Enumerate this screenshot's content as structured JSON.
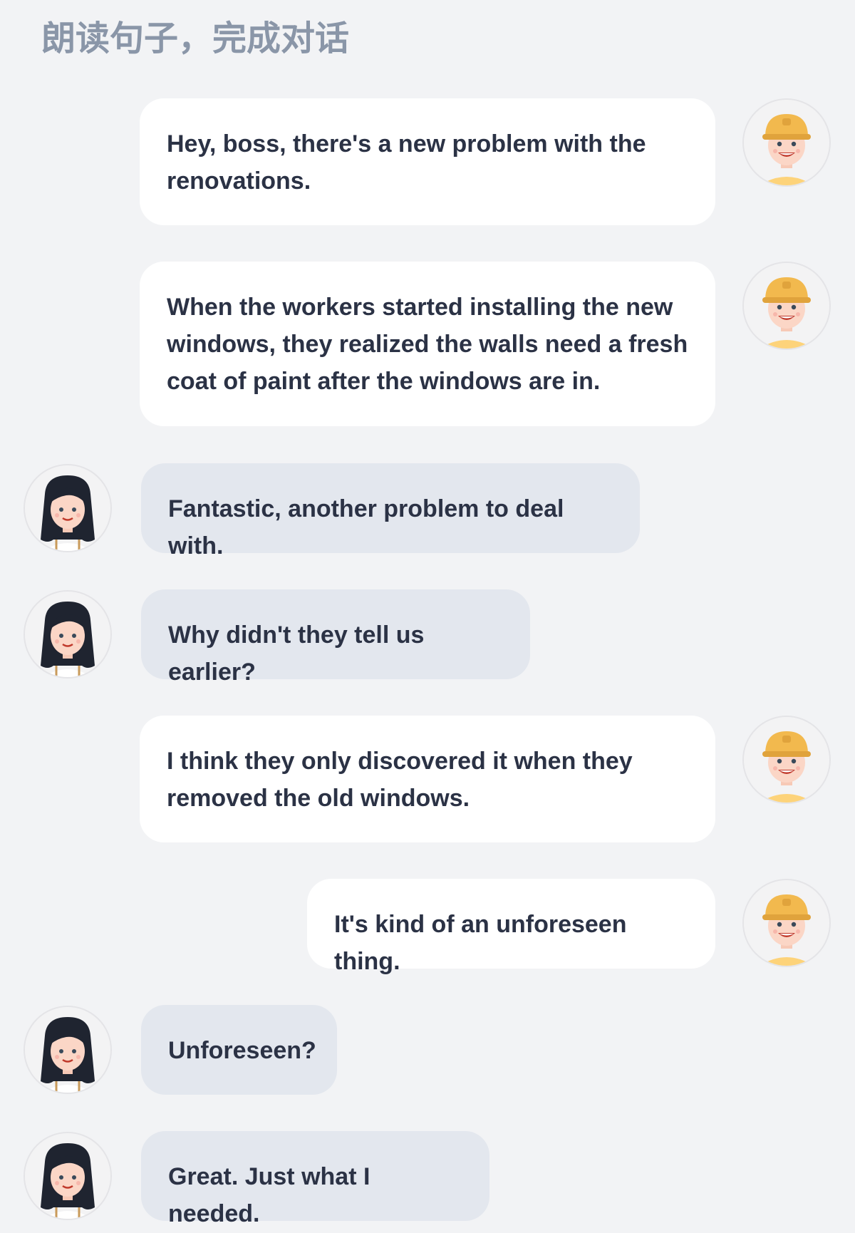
{
  "header": {
    "title": "朗读句子，完成对话"
  },
  "avatars": {
    "worker": "worker-avatar",
    "boss": "boss-avatar"
  },
  "messages": [
    {
      "speaker": "worker",
      "side": "right",
      "text": "Hey, boss, there's a new problem with the renovations."
    },
    {
      "speaker": "worker",
      "side": "right",
      "text": "When the workers started installing the new windows, they realized the walls need a fresh coat of paint after the windows are in."
    },
    {
      "speaker": "boss",
      "side": "left",
      "text": "Fantastic, another problem to deal with."
    },
    {
      "speaker": "boss",
      "side": "left",
      "text": "Why didn't they tell us earlier?"
    },
    {
      "speaker": "worker",
      "side": "right",
      "text": "I think they only discovered it when they removed the old windows."
    },
    {
      "speaker": "worker",
      "side": "right",
      "text": "It's kind of an unforeseen thing."
    },
    {
      "speaker": "boss",
      "side": "left",
      "text": "Unforeseen?"
    },
    {
      "speaker": "boss",
      "side": "left",
      "text": "Great. Just what I needed."
    }
  ]
}
